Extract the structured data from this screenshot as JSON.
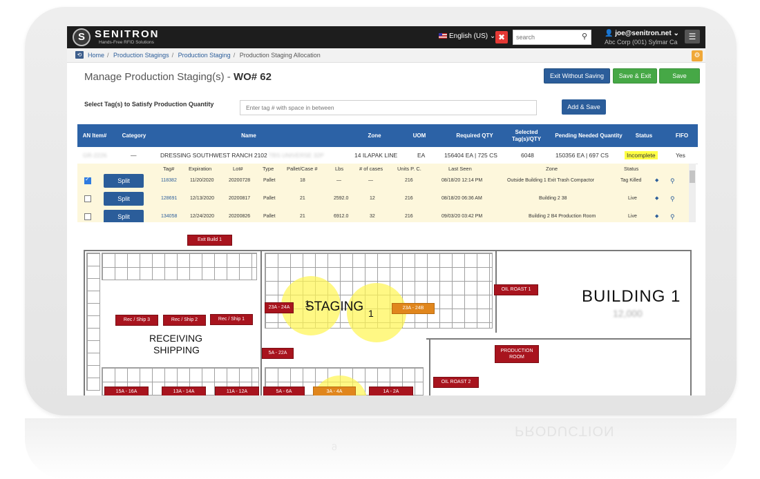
{
  "brand": {
    "name": "SENITRON",
    "tagline": "Hands-Free RFID Solutions",
    "logo_glyph": "S"
  },
  "topnav": {
    "language": "English (US) ⌄",
    "search_placeholder": "search",
    "user_email": "joe@senitron.net ⌄",
    "user_company": "Abc Corp (001) Sylmar Ca",
    "icons": {
      "apps": "x-grid-icon",
      "search": "magnifier-icon",
      "menu": "hamburger-icon",
      "user": "person-icon"
    }
  },
  "breadcrumb": {
    "items": [
      "Home",
      "Production Stagings",
      "Production Staging",
      "Production Staging Allocation"
    ],
    "separator": "/"
  },
  "page": {
    "title_prefix": "Manage Production Staging(s) - ",
    "title_wo": "WO# 62",
    "buttons": {
      "exit_without_saving": "Exit Without Saving",
      "save_exit": "Save & Exit",
      "save": "Save"
    },
    "select_label": "Select Tag(s) to Satisfy Production Quantity",
    "tag_placeholder": "Enter tag # with space in between",
    "add_save": "Add & Save"
  },
  "colors": {
    "primary": "#2c62a6",
    "success": "#46a846",
    "incomplete": "#ffff44",
    "zone": "#a8141e",
    "zone_alt": "#e0861d",
    "heat": "#fff550"
  },
  "main_table": {
    "headers": [
      "AN Item#",
      "Category",
      "Name",
      "Zone",
      "UOM",
      "Required QTY",
      "Selected Tag(s)/QTY",
      "Pending Needed Quantity",
      "Status",
      "FIFO"
    ],
    "row": {
      "an_item": "GR-2226",
      "category": "—",
      "name": "DRESSING SOUTHWEST RANCH 2102",
      "name_blurred": "TBS UNIVERSE 32P",
      "zone": "14 ILAPAK LINE",
      "uom": "EA",
      "required": "156404 EA | 725 CS",
      "selected": "6048",
      "pending": "150356 EA | 697 CS",
      "status": "Incomplete",
      "fifo": "Yes"
    }
  },
  "sub_table": {
    "headers": [
      "Tag#",
      "Expiration",
      "Lot#",
      "Type",
      "Pallet/Case #",
      "Lbs",
      "# of cases",
      "Units P. C.",
      "Last Seen",
      "Zone",
      "Status"
    ],
    "split_label": "Split",
    "rows": [
      {
        "checked": true,
        "tag": "118382",
        "exp": "11/20/2020",
        "lot": "20200728",
        "type": "Pallet",
        "pallet": "18",
        "lbs": "—",
        "cases": "—",
        "units": "216",
        "seen": "08/18/20 12:14 PM",
        "zone": "Outside Building 1 Exit Trash Compactor",
        "status": "Tag Killed"
      },
      {
        "checked": false,
        "tag": "128691",
        "exp": "12/13/2020",
        "lot": "20200817",
        "type": "Pallet",
        "pallet": "21",
        "lbs": "2592.0",
        "cases": "12",
        "units": "216",
        "seen": "08/18/20 06:36 AM",
        "zone": "Building 2 38",
        "status": "Live"
      },
      {
        "checked": false,
        "tag": "134058",
        "exp": "12/24/2020",
        "lot": "20200826",
        "type": "Pallet",
        "pallet": "21",
        "lbs": "6912.0",
        "cases": "32",
        "units": "216",
        "seen": "09/03/20 03:42 PM",
        "zone": "Building 2 B4 Production Room",
        "status": "Live"
      }
    ]
  },
  "map": {
    "building_label": "BUILDING 1",
    "building_sub": "12,000",
    "staging_label": "STAGING",
    "receiving_label": "RECEIVING",
    "shipping_label": "SHIPPING",
    "production_label": "PRODUCTION",
    "zones": {
      "exit_build_1": "Exit Build 1",
      "rec_ship_3": "Rec / Ship 3",
      "rec_ship_2": "Rec / Ship 2",
      "rec_ship_1": "Rec / Ship 1",
      "z23a_24a": "23A - 24A",
      "z23a_24b": "23A - 24B",
      "oil_roast_1": "OIL ROAST 1",
      "z5a_22a": "5A - 22A",
      "production_room": "PRODUCTION ROOM",
      "oil_roast_2": "OIL ROAST 2",
      "z15a_16a": "15A - 16A",
      "z13a_14a": "13A - 14A",
      "z11a_12a": "11A - 12A",
      "z5a_6a": "5A - 6A",
      "z3a_4a": "3A - 4A",
      "z1a_2a": "1A - 2A"
    },
    "counts": {
      "staging_left": "1",
      "staging_right": "1",
      "bottom": "9"
    }
  }
}
